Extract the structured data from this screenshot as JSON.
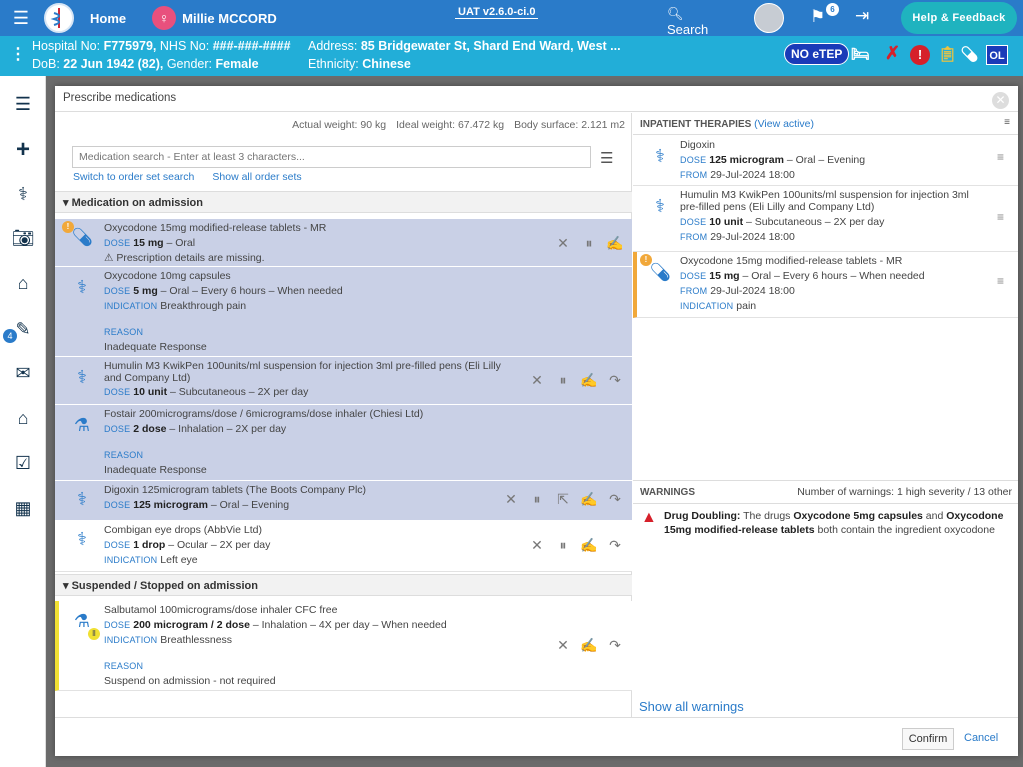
{
  "topbar": {
    "home": "Home",
    "patient": "Millie MCCORD",
    "version": "UAT v2.6.0-ci.0",
    "search": "Search",
    "flag_count": "6",
    "help": "Help & Feedback"
  },
  "patient": {
    "hosp_label": "Hospital No:",
    "hosp_no": "F775979,",
    "nhs_label": "NHS No:",
    "nhs_no": "###-###-####",
    "dob_label": "DoB:",
    "dob": "22 Jun 1942 (82),",
    "gender_label": "Gender:",
    "gender": "Female",
    "addr_label": "Address:",
    "address": "85 Bridgewater St, Shard End Ward, West ...",
    "eth_label": "Ethnicity:",
    "ethnicity": "Chinese",
    "no_etep": "NO eTEP",
    "initials": "OL"
  },
  "sidebar": {
    "badge": "4"
  },
  "modal": {
    "title": "Prescribe medications",
    "actual_weight": "Actual weight: 90 kg",
    "ideal_weight": "Ideal weight: 67.472 kg",
    "body_surface": "Body surface: 2.121 m2",
    "search_placeholder": "Medication search - Enter at least 3 characters...",
    "link_orderset": "Switch to order set search",
    "link_show_all": "Show all order sets",
    "section_admission": "Medication on admission",
    "section_suspended": "Suspended / Stopped on admission",
    "meds": [
      {
        "name": "Oxycodone 15mg modified-release tablets - MR",
        "dose_cap": "DOSE",
        "dose": "15 mg",
        "dose_rest": " – Oral",
        "note": "Prescription details are missing."
      },
      {
        "name": "Oxycodone 10mg capsules",
        "dose_cap": "DOSE",
        "dose": "5 mg",
        "dose_rest": " – Oral – Every 6 hours – When needed",
        "ind_cap": "INDICATION",
        "ind": "Breakthrough pain",
        "reason_cap": "REASON",
        "reason": "Inadequate Response"
      },
      {
        "name": "Humulin M3 KwikPen 100units/ml suspension for injection 3ml pre-filled pens (Eli Lilly and Company Ltd)",
        "dose_cap": "DOSE",
        "dose": "10 unit",
        "dose_rest": " – Subcutaneous – 2X per day"
      },
      {
        "name": "Fostair 200micrograms/dose / 6micrograms/dose inhaler (Chiesi Ltd)",
        "dose_cap": "DOSE",
        "dose": "2 dose",
        "dose_rest": " – Inhalation – 2X per day",
        "reason_cap": "REASON",
        "reason": "Inadequate Response"
      },
      {
        "name": "Digoxin 125microgram tablets (The Boots Company Plc)",
        "dose_cap": "DOSE",
        "dose": "125 microgram",
        "dose_rest": " – Oral – Evening"
      },
      {
        "name": "Combigan eye drops (AbbVie Ltd)",
        "dose_cap": "DOSE",
        "dose": "1 drop",
        "dose_rest": " – Ocular – 2X per day",
        "ind_cap": "INDICATION",
        "ind": "Left eye"
      },
      {
        "name": "Salbutamol 100micrograms/dose inhaler CFC free",
        "dose_cap": "DOSE",
        "dose": "200 microgram / 2 dose",
        "dose_rest": " – Inhalation – 4X per day – When needed",
        "ind_cap": "INDICATION",
        "ind": "Breathlessness",
        "reason_cap": "REASON",
        "reason": "Suspend on admission - not required"
      }
    ],
    "inpatient": {
      "title": "INPATIENT THERAPIES",
      "view_active": "View active",
      "items": [
        {
          "name": "Digoxin",
          "dose_cap": "DOSE",
          "dose": "125 microgram",
          "dose_rest": " – Oral – Evening",
          "from_cap": "FROM",
          "from": "29-Jul-2024 18:00"
        },
        {
          "name": "Humulin M3 KwikPen 100units/ml suspension for injection 3ml pre-filled pens (Eli Lilly and Company Ltd)",
          "dose_cap": "DOSE",
          "dose": "10 unit",
          "dose_rest": " – Subcutaneous – 2X per day",
          "from_cap": "FROM",
          "from": "29-Jul-2024 18:00"
        },
        {
          "name": "Oxycodone 15mg modified-release tablets - MR",
          "dose_cap": "DOSE",
          "dose": "15 mg",
          "dose_rest": " – Oral – Every 6 hours – When needed",
          "from_cap": "FROM",
          "from": "29-Jul-2024 18:00",
          "ind_cap": "INDICATION",
          "ind": "pain"
        }
      ]
    },
    "warnings": {
      "title": "WARNINGS",
      "count": "Number of warnings: 1 high severity / 13 other",
      "w1_title": "Drug Doubling:",
      "w1_a": " The drugs ",
      "w1_drug1": "Oxycodone 5mg capsules",
      "w1_b": " and ",
      "w1_drug2": "Oxycodone 15mg modified-release tablets",
      "w1_c": " both contain the ingredient oxycodone",
      "show_all": "Show all warnings"
    },
    "confirm": "Confirm",
    "cancel": "Cancel"
  },
  "colors": {
    "topbar": "#2a7bc9",
    "patient_bar": "#22aed8",
    "highlight": "#c9d0e6",
    "help": "#1fb3bf",
    "warning": "#d6202a"
  }
}
